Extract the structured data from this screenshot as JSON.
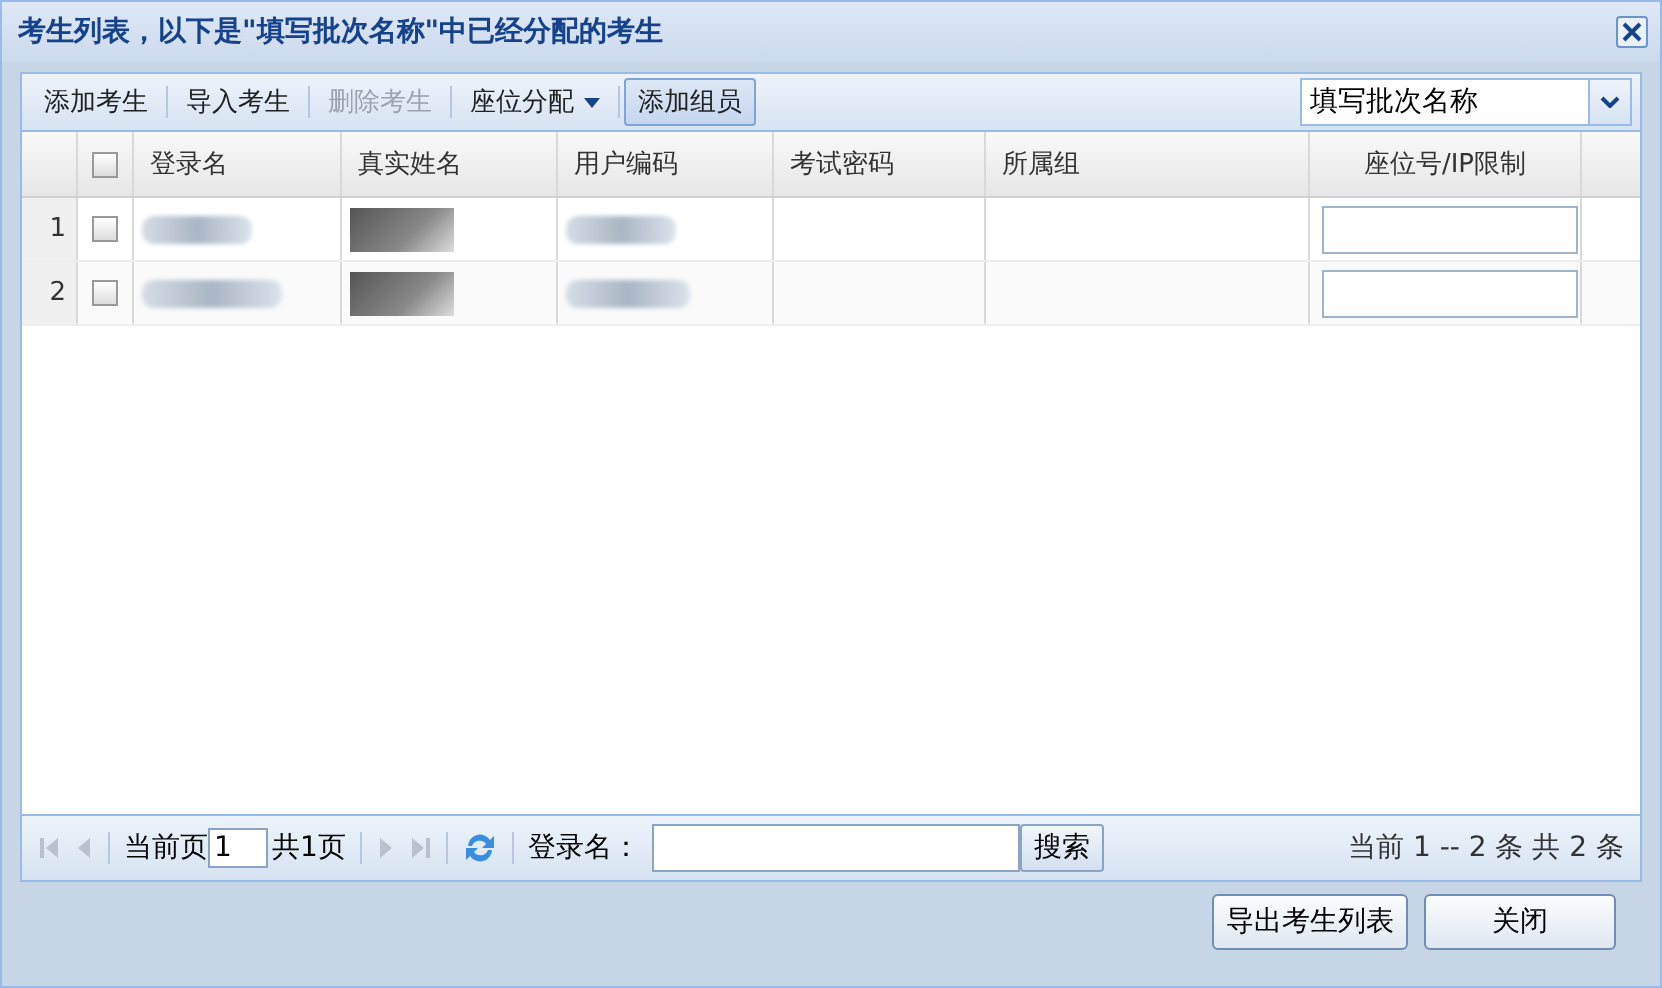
{
  "window": {
    "title": "考生列表，以下是\"填写批次名称\"中已经分配的考生"
  },
  "toolbar": [
    {
      "label": "添加考生",
      "kind": "button",
      "disabled": false
    },
    {
      "label": "导入考生",
      "kind": "button",
      "disabled": false
    },
    {
      "label": "删除考生",
      "kind": "button",
      "disabled": true
    },
    {
      "label": "座位分配",
      "kind": "menu",
      "disabled": false
    },
    {
      "label": "添加组员",
      "kind": "pressed",
      "disabled": false
    }
  ],
  "batch_select": {
    "value": "填写批次名称"
  },
  "table": {
    "select_all_checked": false,
    "columns": [
      "登录名",
      "真实姓名",
      "用户编码",
      "考试密码",
      "所属组",
      "座位号/IP限制"
    ],
    "rows": [
      {
        "number": "1",
        "checked": false
      },
      {
        "number": "2",
        "checked": false
      }
    ]
  },
  "paging": {
    "page_label": "当前页",
    "page": "1",
    "total_pages": "共1页",
    "search_label": "登录名：",
    "search_button": "搜索",
    "summary": "当前 1 -- 2 条 共 2 条"
  },
  "buttons": [
    "导出考生列表",
    "关闭"
  ]
}
